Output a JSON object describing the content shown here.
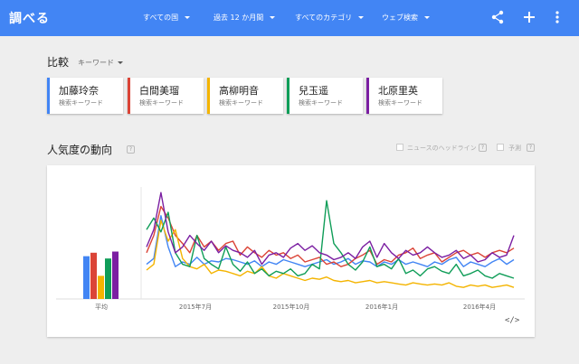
{
  "app": {
    "brand": "調べる"
  },
  "filters": [
    {
      "label": "すべての国"
    },
    {
      "label": "過去 12 か月間"
    },
    {
      "label": "すべてのカテゴリ"
    },
    {
      "label": "ウェブ検索"
    }
  ],
  "icons": {
    "share": "share-icon",
    "add": "plus-icon",
    "menu": "more-vert-icon"
  },
  "compare": {
    "title": "比較",
    "type_label": "キーワード",
    "terms": [
      {
        "name": "加藤玲奈",
        "sub": "検索キーワード",
        "color": "#4285f4"
      },
      {
        "name": "白間美瑠",
        "sub": "検索キーワード",
        "color": "#db4437"
      },
      {
        "name": "高柳明音",
        "sub": "検索キーワード",
        "color": "#f4b400"
      },
      {
        "name": "兒玉遥",
        "sub": "検索キーワード",
        "color": "#0f9d58"
      },
      {
        "name": "北原里英",
        "sub": "検索キーワード",
        "color": "#7b1fa2"
      }
    ]
  },
  "interest": {
    "title": "人気度の動向",
    "help": "?",
    "option_news": "ニュースのヘッドライン",
    "option_forecast": "予測",
    "embed_label": "</>"
  },
  "chart_data": {
    "type": "line",
    "average_label": "平均",
    "average_values": [
      37,
      40,
      20,
      35,
      41
    ],
    "x_tick_labels": [
      "2015年7月",
      "2015年10月",
      "2016年1月",
      "2016年4月"
    ],
    "ylim": [
      0,
      100
    ],
    "series": [
      {
        "color": "#4285f4",
        "values": [
          30,
          35,
          72,
          45,
          28,
          32,
          30,
          36,
          30,
          33,
          32,
          35,
          34,
          32,
          30,
          33,
          28,
          32,
          30,
          34,
          32,
          30,
          28,
          30,
          32,
          34,
          30,
          32,
          35,
          30,
          33,
          32,
          28,
          32,
          30,
          34,
          30,
          32,
          30,
          28,
          32,
          30,
          34,
          36,
          28,
          32,
          30,
          28,
          32,
          35,
          30,
          34
        ]
      },
      {
        "color": "#db4437",
        "values": [
          40,
          55,
          80,
          70,
          55,
          48,
          40,
          55,
          45,
          50,
          42,
          48,
          50,
          38,
          45,
          40,
          36,
          42,
          38,
          40,
          35,
          38,
          32,
          34,
          36,
          30,
          32,
          28,
          30,
          35,
          38,
          42,
          30,
          34,
          32,
          38,
          40,
          44,
          35,
          38,
          40,
          32,
          36,
          40,
          42,
          38,
          40,
          36,
          40,
          42,
          40,
          44
        ]
      },
      {
        "color": "#f4b400",
        "values": [
          25,
          30,
          68,
          50,
          60,
          35,
          28,
          26,
          30,
          22,
          25,
          24,
          22,
          20,
          24,
          22,
          28,
          20,
          18,
          22,
          20,
          18,
          16,
          18,
          17,
          19,
          16,
          15,
          16,
          14,
          15,
          16,
          14,
          15,
          14,
          13,
          12,
          14,
          13,
          12,
          13,
          12,
          14,
          11,
          10,
          12,
          11,
          12,
          10,
          11,
          12,
          10
        ]
      },
      {
        "color": "#0f9d58",
        "values": [
          60,
          70,
          58,
          75,
          40,
          30,
          28,
          55,
          35,
          30,
          26,
          45,
          30,
          24,
          32,
          22,
          26,
          20,
          24,
          22,
          26,
          20,
          22,
          30,
          26,
          85,
          48,
          40,
          30,
          25,
          32,
          45,
          28,
          30,
          26,
          35,
          22,
          25,
          20,
          26,
          28,
          24,
          22,
          30,
          20,
          22,
          25,
          20,
          18,
          22,
          20,
          18
        ]
      },
      {
        "color": "#7b1fa2",
        "values": [
          45,
          60,
          92,
          58,
          40,
          45,
          55,
          48,
          42,
          50,
          40,
          46,
          42,
          40,
          36,
          42,
          30,
          38,
          40,
          36,
          44,
          48,
          42,
          46,
          40,
          38,
          34,
          36,
          40,
          35,
          45,
          50,
          36,
          48,
          40,
          35,
          42,
          38,
          40,
          45,
          40,
          36,
          38,
          42,
          35,
          38,
          32,
          34,
          40,
          36,
          38,
          55
        ]
      }
    ]
  }
}
